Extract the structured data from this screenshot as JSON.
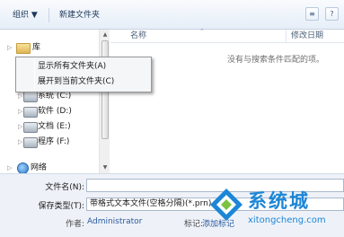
{
  "toolbar": {
    "organize": "组织 ▼",
    "new_folder": "新建文件夹",
    "view_glyph": "≡",
    "help_glyph": "?"
  },
  "nav": {
    "library": "库",
    "items": [
      {
        "label": "系统 (C:)"
      },
      {
        "label": "软件 (D:)"
      },
      {
        "label": "文档 (E:)"
      },
      {
        "label": "程序 (F:)"
      }
    ],
    "network": "网络"
  },
  "content": {
    "col_name": "名称",
    "col_modified": "修改日期",
    "empty_message": "没有与搜索条件匹配的项。"
  },
  "context_menu": {
    "items": [
      "显示所有文件夹(A)",
      "展开到当前文件夹(C)"
    ]
  },
  "save": {
    "filename_label": "文件名(N):",
    "filename_value": "",
    "type_label": "保存类型(T):",
    "type_value": "带格式文本文件(空格分隔)(*.prn)",
    "author_label": "作者:",
    "author_value": "Administrator",
    "tags_label": "标记:",
    "tags_value": "添加标记"
  },
  "watermark": {
    "title": "系统城",
    "url": "xitongcheng.com"
  }
}
